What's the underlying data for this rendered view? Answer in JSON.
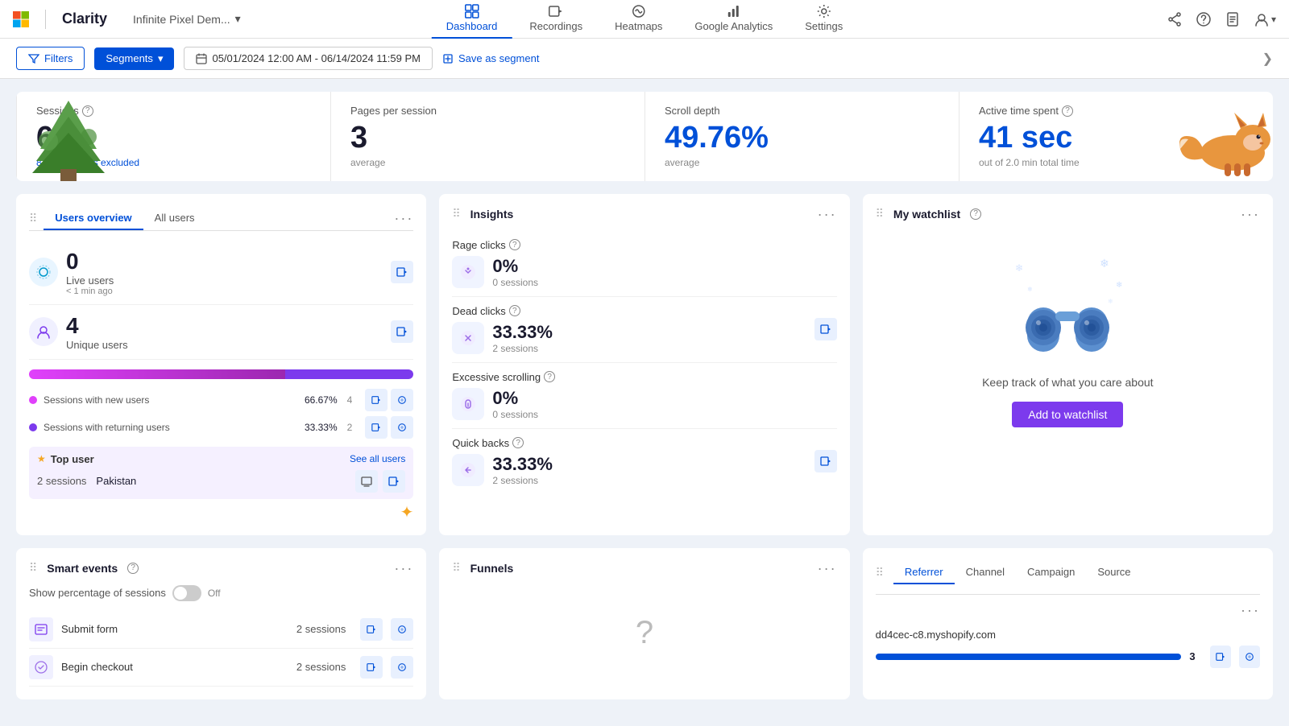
{
  "app": {
    "ms_label": "Microsoft",
    "divider": "|",
    "name": "Clarity",
    "project": "Infinite Pixel Dem...",
    "project_dropdown": "▾"
  },
  "nav": {
    "items": [
      {
        "id": "dashboard",
        "label": "Dashboard",
        "active": true
      },
      {
        "id": "recordings",
        "label": "Recordings",
        "active": false
      },
      {
        "id": "heatmaps",
        "label": "Heatmaps",
        "active": false
      },
      {
        "id": "google_analytics",
        "label": "Google Analytics",
        "active": false
      },
      {
        "id": "settings",
        "label": "Settings",
        "active": false
      }
    ]
  },
  "filters_bar": {
    "filters_label": "Filters",
    "segments_label": "Segments",
    "segments_dropdown": "▾",
    "date_range": "05/01/2024 12:00 AM - 06/14/2024 11:59 PM",
    "cal_icon": "📅",
    "save_segment_label": "Save as segment",
    "expand_icon": "❯"
  },
  "stats": {
    "sessions": {
      "label": "Sessions",
      "value": "6",
      "sub": "8 bot sessions excluded"
    },
    "pages_per_session": {
      "label": "Pages per session",
      "value": "3",
      "sub": "average"
    },
    "scroll_depth": {
      "label": "Scroll depth",
      "value": "49.76%",
      "sub": "average"
    },
    "active_time": {
      "label": "Active time spent",
      "value": "41 sec",
      "sub": "out of 2.0 min total time"
    }
  },
  "users_overview": {
    "title": "Users overview",
    "tabs": [
      "Users overview",
      "All users"
    ],
    "active_tab": "Users overview",
    "live_users": {
      "label": "Live users",
      "value": "0",
      "sublabel": "< 1 min ago"
    },
    "unique_users": {
      "label": "Unique users",
      "value": "4"
    },
    "sessions_new": {
      "label": "Sessions with new users",
      "percent": "66.67%",
      "count": "4"
    },
    "sessions_returning": {
      "label": "Sessions with returning users",
      "percent": "33.33%",
      "count": "2"
    },
    "progress_new_width": "66.67",
    "progress_returning_width": "33.33",
    "top_user_label": "Top user",
    "see_all_label": "See all users",
    "top_user_sessions": "2 sessions",
    "top_user_country": "Pakistan"
  },
  "insights": {
    "title": "Insights",
    "items": [
      {
        "label": "Rage clicks",
        "percent": "0%",
        "sessions": "0 sessions",
        "has_info": true
      },
      {
        "label": "Dead clicks",
        "percent": "33.33%",
        "sessions": "2 sessions",
        "has_info": true
      },
      {
        "label": "Excessive scrolling",
        "percent": "0%",
        "sessions": "0 sessions",
        "has_info": true
      },
      {
        "label": "Quick backs",
        "percent": "33.33%",
        "sessions": "2 sessions",
        "has_info": true
      }
    ]
  },
  "watchlist": {
    "title": "My watchlist",
    "text": "Keep track of what you care about",
    "add_btn": "Add to watchlist"
  },
  "smart_events": {
    "title": "Smart events",
    "toggle_label": "Show percentage of sessions",
    "toggle_state": "Off",
    "items": [
      {
        "name": "Submit form",
        "sessions": "2 sessions"
      },
      {
        "name": "Begin checkout",
        "sessions": "2 sessions"
      }
    ]
  },
  "funnels": {
    "title": "Funnels",
    "empty_symbol": "?"
  },
  "referrer": {
    "title": "Referrer",
    "tabs": [
      "Referrer",
      "Channel",
      "Campaign",
      "Source"
    ],
    "active_tab": "Referrer",
    "items": [
      {
        "domain": "dd4cec-c8.myshopify.com",
        "count": 3,
        "bar_width": "85"
      }
    ]
  },
  "colors": {
    "primary": "#0050d8",
    "accent_purple": "#7c3aed",
    "accent_pink": "#e040fb",
    "success": "#00c853",
    "bar_blue": "#0050d8",
    "progress_new": "#c026d3",
    "progress_returning": "#7c3aed"
  }
}
